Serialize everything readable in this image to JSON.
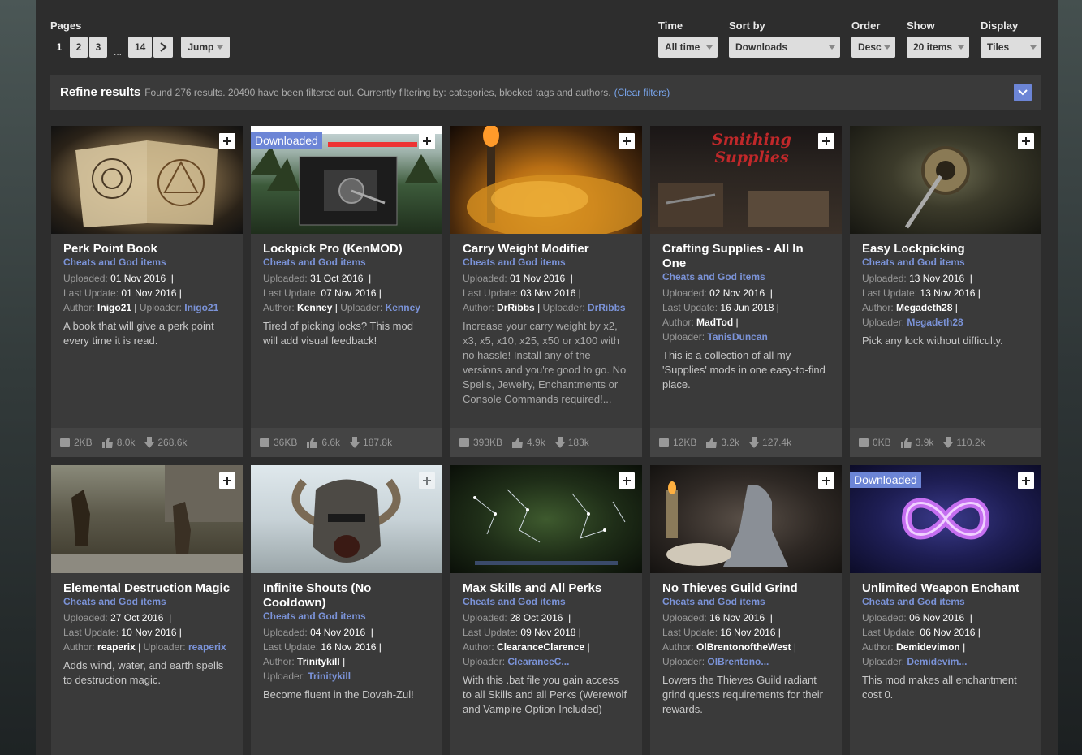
{
  "pagination": {
    "label": "Pages",
    "pages": [
      "1",
      "2",
      "3",
      "14"
    ],
    "ellipsis": "...",
    "jump_label": "Jump"
  },
  "filters": {
    "time": {
      "label": "Time",
      "value": "All time"
    },
    "sort": {
      "label": "Sort by",
      "value": "Downloads"
    },
    "order": {
      "label": "Order",
      "value": "Desc"
    },
    "show": {
      "label": "Show",
      "value": "20 items"
    },
    "display": {
      "label": "Display",
      "value": "Tiles"
    }
  },
  "refine": {
    "title": "Refine results",
    "summary": "Found 276 results. 20490 have been filtered out. Currently filtering by: categories, blocked tags and authors.",
    "clear_open": "(",
    "clear_link": "Clear filters",
    "clear_close": ")"
  },
  "colors": {
    "accent": "#6c85d6",
    "link": "#7b93d8",
    "panel": "#2d2d2d",
    "tile": "#3a3a3a"
  },
  "mods": [
    {
      "title": "Perk Point Book",
      "category": "Cheats and God items",
      "uploaded": "01 Nov 2016",
      "updated": "01 Nov 2016",
      "author": "Inigo21",
      "uploader": "Inigo21",
      "description": "A book that will give a perk point every time it is read.",
      "size": "2KB",
      "endorsements": "8.0k",
      "downloads": "268.6k",
      "badge": "",
      "icon": "plus-icon"
    },
    {
      "title": "Lockpick Pro (KenMOD)",
      "category": "Cheats and God items",
      "uploaded": "31 Oct 2016",
      "updated": "07 Nov 2016",
      "author": "Kenney",
      "uploader": "Kenney",
      "description": "Tired of picking locks? This mod will add visual feedback!",
      "size": "36KB",
      "endorsements": "6.6k",
      "downloads": "187.8k",
      "badge": "Downloaded",
      "icon": "plus-icon"
    },
    {
      "title": "Carry Weight Modifier",
      "category": "Cheats and God items",
      "uploaded": "01 Nov 2016",
      "updated": "03 Nov 2016",
      "author": "DrRibbs",
      "uploader": "DrRibbs",
      "description": "Increase your carry weight by x2, x3, x5, x10, x25, x50 or x100 with no hassle! Install any of the versions and you're good to go. No Spells, Jewelry, Enchantments or Console Commands required!...",
      "size": "393KB",
      "endorsements": "4.9k",
      "downloads": "183k",
      "badge": "",
      "icon": "plus-icon"
    },
    {
      "title": "Crafting Supplies - All In One",
      "category": "Cheats and God items",
      "uploaded": "02 Nov 2016",
      "updated": "16 Jun 2018",
      "author": "MadTod",
      "uploader": "TanisDuncan",
      "description": "This is a collection of all my 'Supplies' mods in one easy-to-find place.",
      "size": "12KB",
      "endorsements": "3.2k",
      "downloads": "127.4k",
      "badge": "",
      "thumb_text": "Smithing Supplies",
      "icon": "plus-icon"
    },
    {
      "title": "Easy Lockpicking",
      "category": "Cheats and God items",
      "uploaded": "13 Nov 2016",
      "updated": "13 Nov 2016",
      "author": "Megadeth28",
      "uploader": "Megadeth28",
      "description": "Pick any lock without difficulty.",
      "size": "0KB",
      "endorsements": "3.9k",
      "downloads": "110.2k",
      "badge": "",
      "icon": "plus-icon"
    },
    {
      "title": "Elemental Destruction Magic",
      "category": "Cheats and God items",
      "uploaded": "27 Oct 2016",
      "updated": "10 Nov 2016",
      "author": "reaperix",
      "uploader": "reaperix",
      "description": "Adds wind, water, and earth spells to destruction magic.",
      "badge": "",
      "icon": "plus-icon"
    },
    {
      "title": "Infinite Shouts (No Cooldown)",
      "category": "Cheats and God items",
      "uploaded": "04 Nov 2016",
      "updated": "16 Nov 2016",
      "author": "Trinitykill",
      "uploader": "Trinitykill",
      "description": "Become fluent in the Dovah-Zul!",
      "badge": "",
      "icon": "plus-icon"
    },
    {
      "title": "Max Skills and All Perks",
      "category": "Cheats and God items",
      "uploaded": "28 Oct 2016",
      "updated": "09 Nov 2018",
      "author": "ClearanceClarence",
      "uploader": "ClearanceC...",
      "description": "With this .bat file you gain access to all Skills and all Perks (Werewolf and Vampire Option Included)",
      "badge": "",
      "icon": "plus-icon"
    },
    {
      "title": "No Thieves Guild Grind",
      "category": "Cheats and God items",
      "uploaded": "16 Nov 2016",
      "updated": "16 Nov 2016",
      "author": "OlBrentonoftheWest",
      "uploader": "OlBrentono...",
      "description": "Lowers the Thieves Guild radiant grind quests requirements for their rewards.",
      "badge": "",
      "icon": "plus-icon"
    },
    {
      "title": "Unlimited Weapon Enchant",
      "category": "Cheats and God items",
      "uploaded": "06 Nov 2016",
      "updated": "06 Nov 2016",
      "author": "Demidevimon",
      "uploader": "Demidevim...",
      "description": "This mod makes all enchantment cost 0.",
      "badge": "Downloaded",
      "icon": "plus-icon"
    }
  ],
  "labels": {
    "uploaded": "Uploaded:",
    "updated": "Last Update:",
    "author": "Author:",
    "uploader": "Uploader:",
    "sep": "|"
  }
}
